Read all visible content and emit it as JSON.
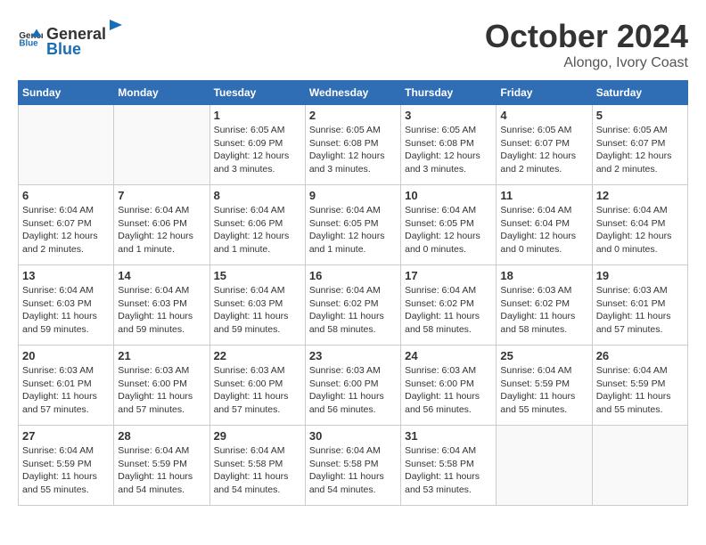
{
  "header": {
    "logo_general": "General",
    "logo_blue": "Blue",
    "month": "October 2024",
    "location": "Alongo, Ivory Coast"
  },
  "weekdays": [
    "Sunday",
    "Monday",
    "Tuesday",
    "Wednesday",
    "Thursday",
    "Friday",
    "Saturday"
  ],
  "weeks": [
    [
      {
        "day": "",
        "info": ""
      },
      {
        "day": "",
        "info": ""
      },
      {
        "day": "1",
        "info": "Sunrise: 6:05 AM\nSunset: 6:09 PM\nDaylight: 12 hours and 3 minutes."
      },
      {
        "day": "2",
        "info": "Sunrise: 6:05 AM\nSunset: 6:08 PM\nDaylight: 12 hours and 3 minutes."
      },
      {
        "day": "3",
        "info": "Sunrise: 6:05 AM\nSunset: 6:08 PM\nDaylight: 12 hours and 3 minutes."
      },
      {
        "day": "4",
        "info": "Sunrise: 6:05 AM\nSunset: 6:07 PM\nDaylight: 12 hours and 2 minutes."
      },
      {
        "day": "5",
        "info": "Sunrise: 6:05 AM\nSunset: 6:07 PM\nDaylight: 12 hours and 2 minutes."
      }
    ],
    [
      {
        "day": "6",
        "info": "Sunrise: 6:04 AM\nSunset: 6:07 PM\nDaylight: 12 hours and 2 minutes."
      },
      {
        "day": "7",
        "info": "Sunrise: 6:04 AM\nSunset: 6:06 PM\nDaylight: 12 hours and 1 minute."
      },
      {
        "day": "8",
        "info": "Sunrise: 6:04 AM\nSunset: 6:06 PM\nDaylight: 12 hours and 1 minute."
      },
      {
        "day": "9",
        "info": "Sunrise: 6:04 AM\nSunset: 6:05 PM\nDaylight: 12 hours and 1 minute."
      },
      {
        "day": "10",
        "info": "Sunrise: 6:04 AM\nSunset: 6:05 PM\nDaylight: 12 hours and 0 minutes."
      },
      {
        "day": "11",
        "info": "Sunrise: 6:04 AM\nSunset: 6:04 PM\nDaylight: 12 hours and 0 minutes."
      },
      {
        "day": "12",
        "info": "Sunrise: 6:04 AM\nSunset: 6:04 PM\nDaylight: 12 hours and 0 minutes."
      }
    ],
    [
      {
        "day": "13",
        "info": "Sunrise: 6:04 AM\nSunset: 6:03 PM\nDaylight: 11 hours and 59 minutes."
      },
      {
        "day": "14",
        "info": "Sunrise: 6:04 AM\nSunset: 6:03 PM\nDaylight: 11 hours and 59 minutes."
      },
      {
        "day": "15",
        "info": "Sunrise: 6:04 AM\nSunset: 6:03 PM\nDaylight: 11 hours and 59 minutes."
      },
      {
        "day": "16",
        "info": "Sunrise: 6:04 AM\nSunset: 6:02 PM\nDaylight: 11 hours and 58 minutes."
      },
      {
        "day": "17",
        "info": "Sunrise: 6:04 AM\nSunset: 6:02 PM\nDaylight: 11 hours and 58 minutes."
      },
      {
        "day": "18",
        "info": "Sunrise: 6:03 AM\nSunset: 6:02 PM\nDaylight: 11 hours and 58 minutes."
      },
      {
        "day": "19",
        "info": "Sunrise: 6:03 AM\nSunset: 6:01 PM\nDaylight: 11 hours and 57 minutes."
      }
    ],
    [
      {
        "day": "20",
        "info": "Sunrise: 6:03 AM\nSunset: 6:01 PM\nDaylight: 11 hours and 57 minutes."
      },
      {
        "day": "21",
        "info": "Sunrise: 6:03 AM\nSunset: 6:00 PM\nDaylight: 11 hours and 57 minutes."
      },
      {
        "day": "22",
        "info": "Sunrise: 6:03 AM\nSunset: 6:00 PM\nDaylight: 11 hours and 57 minutes."
      },
      {
        "day": "23",
        "info": "Sunrise: 6:03 AM\nSunset: 6:00 PM\nDaylight: 11 hours and 56 minutes."
      },
      {
        "day": "24",
        "info": "Sunrise: 6:03 AM\nSunset: 6:00 PM\nDaylight: 11 hours and 56 minutes."
      },
      {
        "day": "25",
        "info": "Sunrise: 6:04 AM\nSunset: 5:59 PM\nDaylight: 11 hours and 55 minutes."
      },
      {
        "day": "26",
        "info": "Sunrise: 6:04 AM\nSunset: 5:59 PM\nDaylight: 11 hours and 55 minutes."
      }
    ],
    [
      {
        "day": "27",
        "info": "Sunrise: 6:04 AM\nSunset: 5:59 PM\nDaylight: 11 hours and 55 minutes."
      },
      {
        "day": "28",
        "info": "Sunrise: 6:04 AM\nSunset: 5:59 PM\nDaylight: 11 hours and 54 minutes."
      },
      {
        "day": "29",
        "info": "Sunrise: 6:04 AM\nSunset: 5:58 PM\nDaylight: 11 hours and 54 minutes."
      },
      {
        "day": "30",
        "info": "Sunrise: 6:04 AM\nSunset: 5:58 PM\nDaylight: 11 hours and 54 minutes."
      },
      {
        "day": "31",
        "info": "Sunrise: 6:04 AM\nSunset: 5:58 PM\nDaylight: 11 hours and 53 minutes."
      },
      {
        "day": "",
        "info": ""
      },
      {
        "day": "",
        "info": ""
      }
    ]
  ]
}
